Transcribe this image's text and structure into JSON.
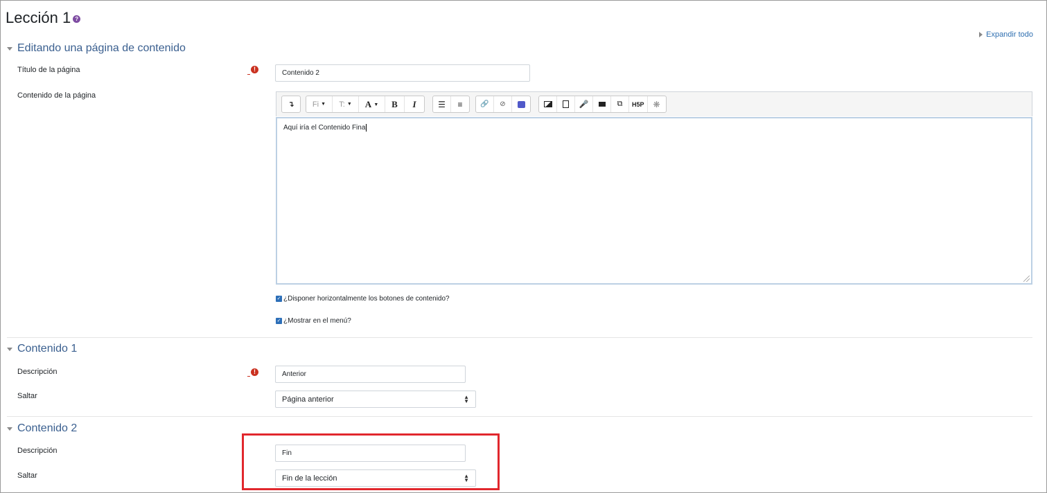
{
  "page": {
    "title": "Lección 1",
    "help_icon": "question-circle-icon",
    "expand_all": "Expandir todo"
  },
  "sections": {
    "editing": {
      "header": "Editando una página de contenido",
      "title_label": "Título de la página",
      "title_value": "Contenido 2",
      "content_label": "Contenido de la página",
      "editor_text": "Aquí iría el Contenido Fina",
      "checkbox_horizontal": "¿Disponer horizontalmente los botones de contenido?",
      "checkbox_menu": "¿Mostrar en el menú?"
    },
    "content1": {
      "header": "Contenido 1",
      "description_label": "Descripción",
      "description_value": "Anterior",
      "jump_label": "Saltar",
      "jump_value": "Página anterior"
    },
    "content2": {
      "header": "Contenido 2",
      "description_label": "Descripción",
      "description_value": "Fin",
      "jump_label": "Saltar",
      "jump_value": "Fin de la lección"
    }
  },
  "toolbar": {
    "font_family": "Fi",
    "font_size": "T:",
    "font_color": "A",
    "bold": "B",
    "italic": "I",
    "h5p": "H5P"
  },
  "colors": {
    "section_header": "#3a5f8f",
    "required": "#ca3120",
    "highlight": "#e1272d",
    "checkbox": "#2d6fb8"
  }
}
